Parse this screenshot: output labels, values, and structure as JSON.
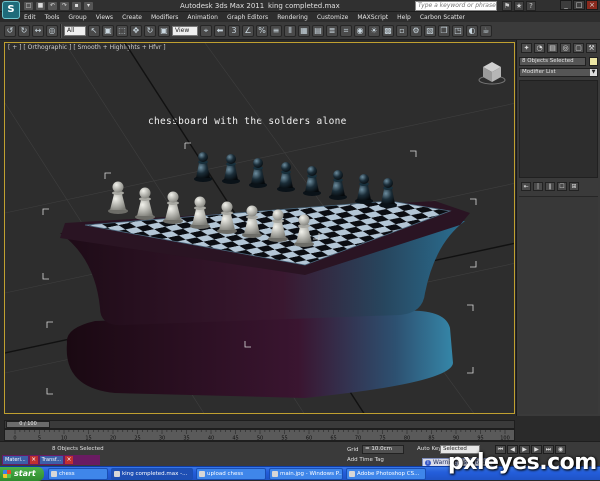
{
  "app": {
    "logo": "S",
    "title": "Autodesk 3ds Max  2011",
    "file": "king completed.max",
    "search_placeholder": "Type a keyword or phrase",
    "quick_access": [
      "□",
      "■",
      "↶",
      "↷",
      "▪",
      "▾"
    ],
    "title_icons": [
      "⚑",
      "★",
      "?"
    ],
    "window_controls": [
      "_",
      "□",
      "×"
    ]
  },
  "menu": [
    "Edit",
    "Tools",
    "Group",
    "Views",
    "Create",
    "Modifiers",
    "Animation",
    "Graph Editors",
    "Rendering",
    "Customize",
    "MAXScript",
    "Help",
    "Carbon Scatter"
  ],
  "toolbar": {
    "icons_left": [
      "↺",
      "↻",
      "↔",
      "◎"
    ],
    "selection_filter": "All",
    "icons_mid": [
      "↖",
      "▣",
      "⬚",
      "✥",
      "↻",
      "▣"
    ],
    "reference_coord": "View",
    "icons_right": [
      "⌖",
      "⬅",
      "3",
      "∠",
      "%",
      "≡",
      "⫴",
      "▦",
      "▤",
      "≣",
      "⌗",
      "◉",
      "☀",
      "▩",
      "▫",
      "⚙",
      "▧",
      "❐",
      "◳",
      "◐",
      "☕"
    ]
  },
  "viewport": {
    "label": "[ + ] [ Orthographic ] [ Smooth + Highlights + Hfvr ]",
    "annotation": "chessboard with the solders alone"
  },
  "command_panel": {
    "tabs": [
      "✦",
      "◔",
      "▤",
      "◎",
      "▢",
      "⚒"
    ],
    "selection_name": "8 Objects Selected",
    "modifier_list": "Modifier List",
    "stack_tools": [
      "⇤",
      "|",
      "∥",
      "☐",
      "⊞"
    ]
  },
  "timeline": {
    "frame_indicator": "0 / 100",
    "ticks": [
      "0",
      "5",
      "10",
      "15",
      "20",
      "25",
      "30",
      "35",
      "40",
      "45",
      "50",
      "55",
      "60",
      "65",
      "70",
      "75",
      "80",
      "85",
      "90",
      "95",
      "100"
    ]
  },
  "status": {
    "objects_selected": "8 Objects Selected",
    "grid_label": "Grid",
    "grid_value": "= 10.0cm",
    "add_time_tag": "Add Time Tag",
    "autokey_label": "Auto Key",
    "autokey_value": "Selected",
    "warning": "Warning: Isolated",
    "mini_listener": [
      "Materi...",
      "Transf..."
    ],
    "play_controls": [
      "⏮",
      "◀",
      "▶",
      "▶",
      "⏭",
      "◉"
    ]
  },
  "taskbar": {
    "start": "start",
    "tasks": [
      "chess",
      "king completed.max -...",
      "upload chess",
      "main.jpg - Windows P...",
      "Adobe Photoshop CS..."
    ]
  },
  "watermark": "pxleyes.com",
  "colors": {
    "viewport_bg": "#2d2d2d",
    "board_wood": "#2a1220",
    "board_highlight": "#1f5e80",
    "white_pieces": "#b9b9b2",
    "black_pieces": "#0d1a22",
    "taskbar": "#245edb"
  }
}
